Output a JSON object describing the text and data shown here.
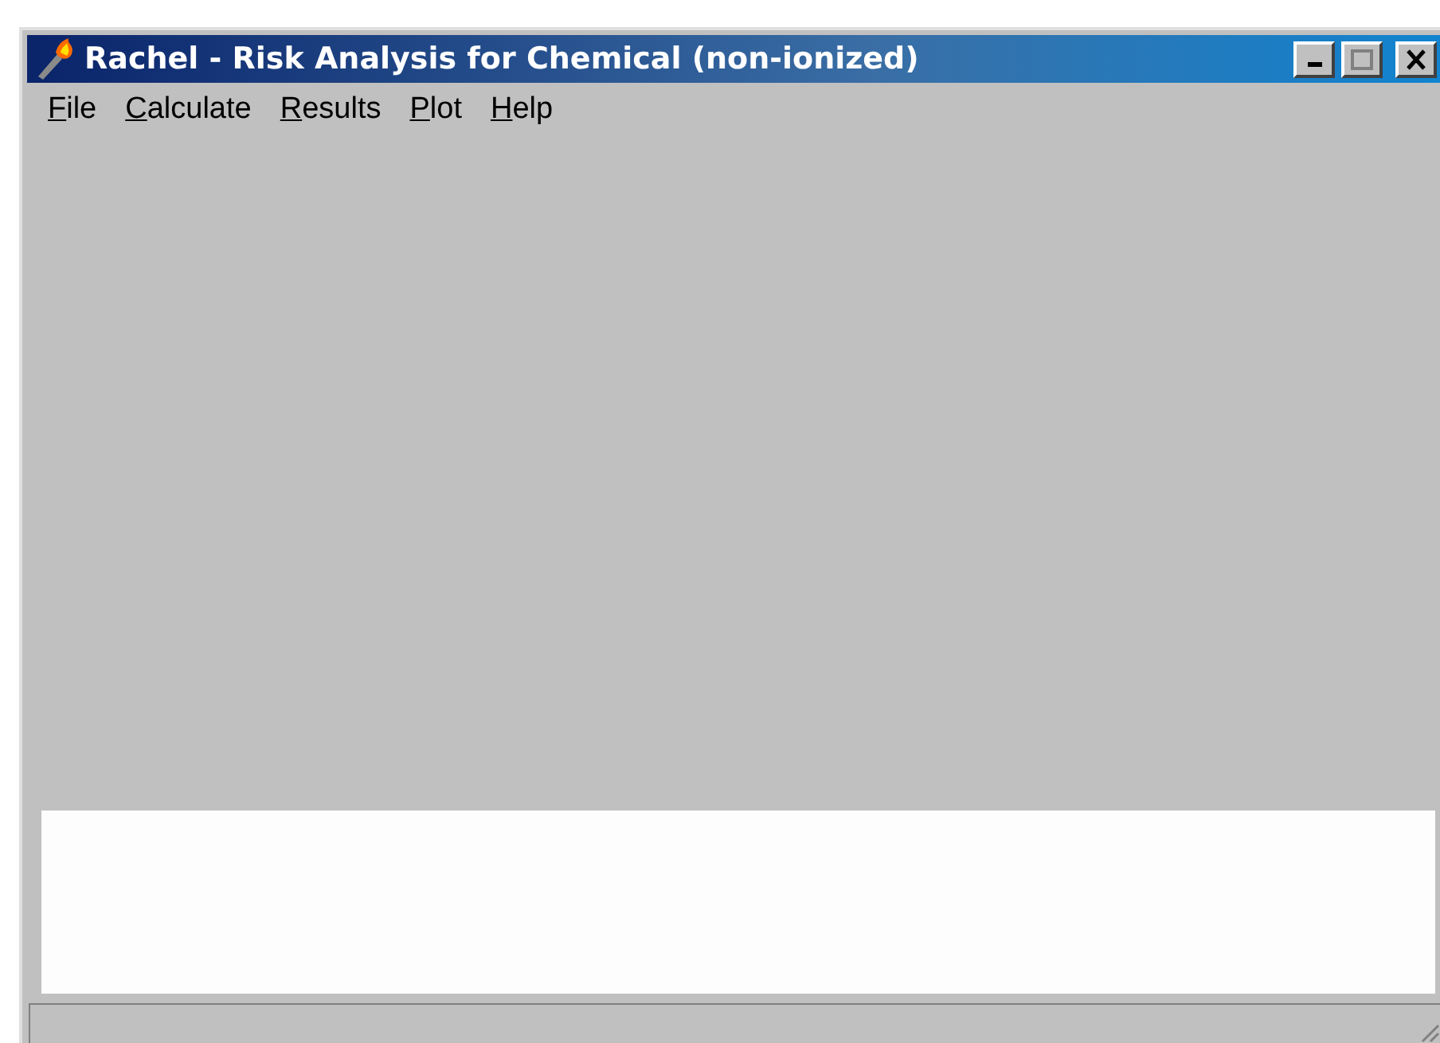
{
  "window": {
    "title": "Rachel - Risk Analysis for Chemical (non-ionized)"
  },
  "menu": [
    {
      "label": "File"
    },
    {
      "label": "Calculate"
    },
    {
      "label": "Results"
    },
    {
      "label": "Plot"
    },
    {
      "label": "Help"
    }
  ]
}
